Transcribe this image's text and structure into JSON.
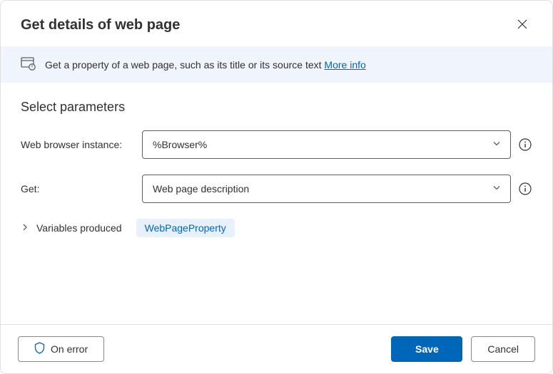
{
  "header": {
    "title": "Get details of web page"
  },
  "banner": {
    "text": "Get a property of a web page, such as its title or its source text ",
    "more_info": "More info"
  },
  "section": {
    "title": "Select parameters"
  },
  "fields": {
    "browser": {
      "label": "Web browser instance:",
      "value": "%Browser%"
    },
    "get": {
      "label": "Get:",
      "value": "Web page description"
    }
  },
  "variables": {
    "label": "Variables produced",
    "pill": "WebPageProperty"
  },
  "footer": {
    "on_error": "On error",
    "save": "Save",
    "cancel": "Cancel"
  }
}
